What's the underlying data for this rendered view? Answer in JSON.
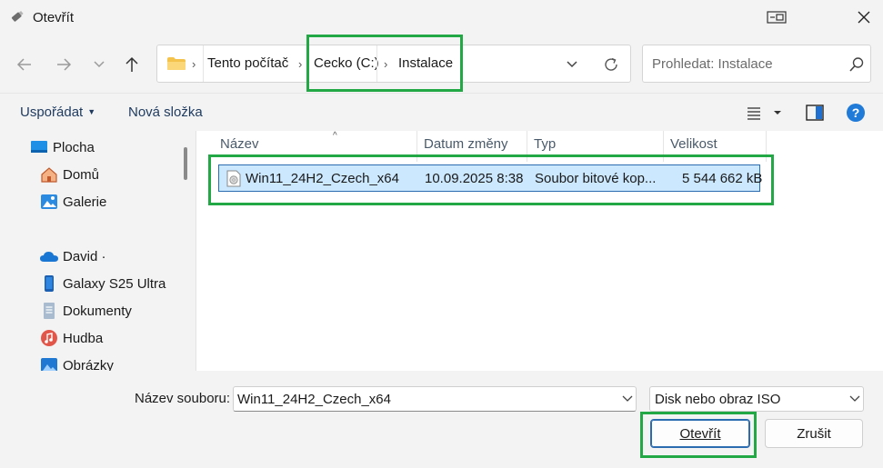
{
  "window": {
    "title": "Otevřít",
    "icons": {
      "app": "pen-drive-icon",
      "compact": "compact-view-icon",
      "close": "close-icon"
    }
  },
  "nav": {
    "back_icon": "arrow-left-icon",
    "forward_icon": "arrow-right-icon",
    "recent_icon": "chevron-down-icon",
    "up_icon": "arrow-up-icon"
  },
  "address": {
    "crumbs": [
      "Tento počítač",
      "Cecko (C:)",
      "Instalace"
    ],
    "folder_icon": "folder-icon",
    "dropdown_icon": "chevron-down-icon",
    "refresh_icon": "refresh-icon"
  },
  "search": {
    "placeholder": "Prohledat: Instalace",
    "icon": "search-icon"
  },
  "toolbar": {
    "organize_label": "Uspořádat",
    "new_folder_label": "Nová složka",
    "view_icon": "list-view-icon",
    "preview_icon": "preview-pane-icon",
    "help_icon": "help-icon"
  },
  "sidebar": {
    "items": [
      {
        "label": "Plocha",
        "icon": "desktop-icon"
      },
      {
        "label": "Domů",
        "icon": "home-icon"
      },
      {
        "label": "Galerie",
        "icon": "gallery-icon"
      },
      {
        "label": "David ·",
        "icon": "onedrive-cloud-icon"
      },
      {
        "label": "Galaxy S25 Ultra",
        "icon": "phone-icon"
      },
      {
        "label": "Dokumenty",
        "icon": "documents-icon"
      },
      {
        "label": "Hudba",
        "icon": "music-icon"
      },
      {
        "label": "Obrázky",
        "icon": "pictures-icon"
      }
    ]
  },
  "files": {
    "columns": [
      "Název",
      "Datum změny",
      "Typ",
      "Velikost"
    ],
    "rows": [
      {
        "name": "Win11_24H2_Czech_x64",
        "date": "10.09.2025 8:38",
        "type": "Soubor bitové kop...",
        "size": "5 544 662 kB",
        "icon": "disc-image-icon"
      }
    ]
  },
  "footer": {
    "filename_label": "Název souboru:",
    "filename_value": "Win11_24H2_Czech_x64",
    "filetype_value": "Disk nebo obraz ISO",
    "open_label": "Otevřít",
    "cancel_label": "Zrušit"
  },
  "colors": {
    "highlight": "#22a845",
    "selection_bg": "#cce8ff",
    "accent": "#2b6cb0"
  }
}
